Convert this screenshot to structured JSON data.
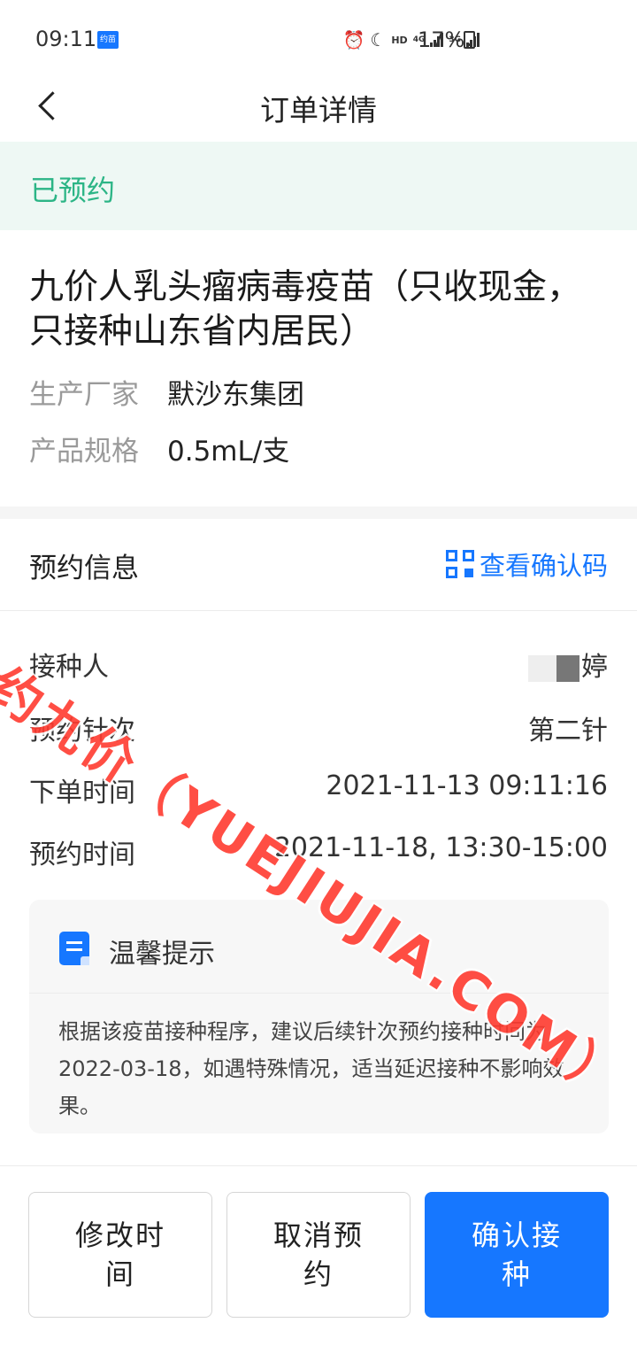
{
  "status_bar": {
    "time": "09:11",
    "app_badge": "约苗",
    "network_hd": "HD",
    "network_4g": "4G",
    "network_3g": "3G",
    "battery": "17%"
  },
  "nav": {
    "title": "订单详情",
    "icon": "back-chevron-icon"
  },
  "order_status": {
    "text": "已预约",
    "color": "#2cb586"
  },
  "product": {
    "title": "九价人乳头瘤病毒疫苗（只收现金，只接种山东省内居民）",
    "manufacturer_label": "生产厂家",
    "manufacturer_value": "默沙东集团",
    "spec_label": "产品规格",
    "spec_value": "0.5mL/支"
  },
  "appointment": {
    "section_title": "预约信息",
    "qr_link_label": "查看确认码",
    "rows": [
      {
        "label": "接种人",
        "value": "婷"
      },
      {
        "label": "预约针次",
        "value": "第二针"
      },
      {
        "label": "下单时间",
        "value": "2021-11-13 09:11:16"
      },
      {
        "label": "预约时间",
        "value": "2021-11-18, 13:30-15:00"
      }
    ]
  },
  "tips": {
    "title": "温馨提示",
    "body": "根据该疫苗接种程序，建议后续针次预约接种时间为2022-03-18，如遇特殊情况，适当延迟接种不影响效果。"
  },
  "actions": {
    "modify_time": "修改时间",
    "cancel": "取消预约",
    "confirm": "确认接种"
  },
  "watermark": "约九价（YUEJIUJIA.COM）",
  "colors": {
    "accent": "#1677ff",
    "status_green": "#2cb586",
    "watermark_red": "#ff3b30"
  }
}
